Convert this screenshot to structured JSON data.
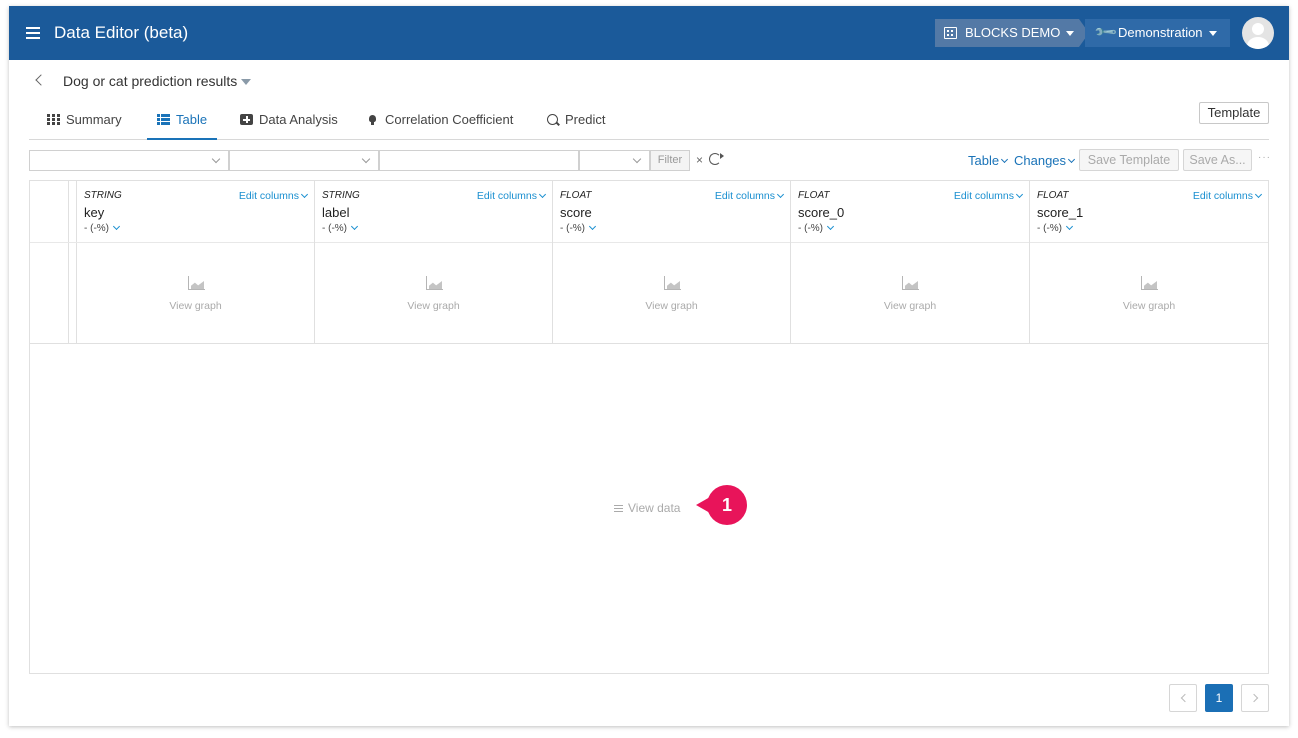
{
  "header": {
    "app_title": "Data Editor (beta)",
    "org_label": "BLOCKS DEMO",
    "project_label": "Demonstration"
  },
  "dataset": {
    "title": "Dog or cat prediction results"
  },
  "tabs": [
    {
      "label": "Summary",
      "icon": "grid-icon"
    },
    {
      "label": "Table",
      "icon": "table-icon",
      "active": true
    },
    {
      "label": "Data Analysis",
      "icon": "plus-square-icon"
    },
    {
      "label": "Correlation Coefficient",
      "icon": "lightbulb-icon"
    },
    {
      "label": "Predict",
      "icon": "search-chart-icon"
    }
  ],
  "template_button": "Template",
  "toolbar": {
    "filter_label": "Filter",
    "clear_symbol": "×",
    "table_link": "Table",
    "changes_link": "Changes",
    "save_template": "Save Template",
    "save_as": "Save As...",
    "more": "···"
  },
  "columns": [
    {
      "type": "STRING",
      "name": "key",
      "stat": "- (-%)",
      "edit": "Edit columns",
      "graph": "View graph"
    },
    {
      "type": "STRING",
      "name": "label",
      "stat": "- (-%)",
      "edit": "Edit columns",
      "graph": "View graph"
    },
    {
      "type": "FLOAT",
      "name": "score",
      "stat": "- (-%)",
      "edit": "Edit columns",
      "graph": "View graph"
    },
    {
      "type": "FLOAT",
      "name": "score_0",
      "stat": "- (-%)",
      "edit": "Edit columns",
      "graph": "View graph"
    },
    {
      "type": "FLOAT",
      "name": "score_1",
      "stat": "- (-%)",
      "edit": "Edit columns",
      "graph": "View graph"
    }
  ],
  "view_data": "View data",
  "marker": "1",
  "pagination": {
    "current": "1"
  },
  "colors": {
    "header_bg": "#1b5a9a",
    "accent": "#1a73b8",
    "marker": "#e8145a"
  }
}
